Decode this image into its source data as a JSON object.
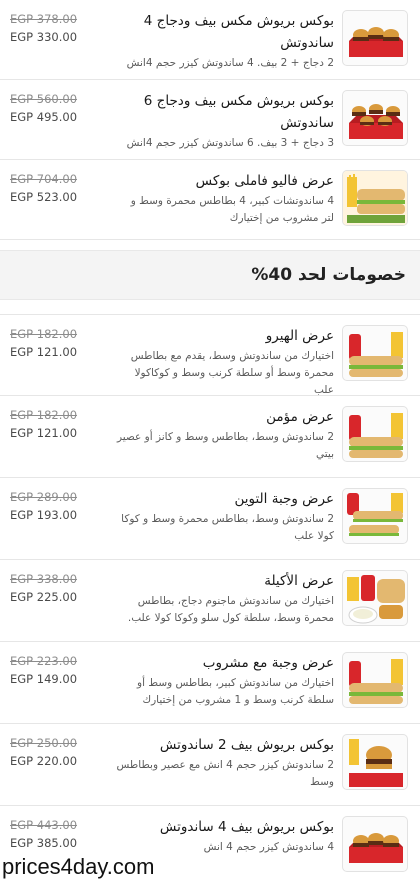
{
  "top_items": [
    {
      "title": "بوكس بريوش مكس بيف ودجاج 4 ساندوتش",
      "desc": "2 دجاج + 2 بيف. 4 ساندوتش كيزر حجم 4انش",
      "old_price": "EGP 378.00",
      "new_price": "EGP 330.00",
      "image": "sliders-box-image"
    },
    {
      "title": "بوكس بريوش مكس بيف ودجاج 6 ساندوتش",
      "desc": "3 دجاج + 3 بيف. 6 ساندوتش كيزر حجم 4انش",
      "old_price": "EGP 560.00",
      "new_price": "EGP 495.00",
      "image": "sliders-box-image"
    },
    {
      "title": "عرض فاليو فاملى بوكس",
      "desc": "4 ساندوتشات كبير، 4 بطاطس محمرة وسط و لتر مشروب من إختيارك",
      "old_price": "EGP 704.00",
      "new_price": "EGP 523.00",
      "image": "family-box-image"
    }
  ],
  "section": {
    "title": "خصومات لحد 40%"
  },
  "discount_items": [
    {
      "title": "عرض الهيرو",
      "desc": "اختيارك من ساندوتش وسط، يقدم مع بطاطس محمرة وسط أو سلطة كرنب وسط و كوكاكولا علب",
      "old_price": "EGP 182.00",
      "new_price": "EGP 121.00",
      "image": "sub-combo-image"
    },
    {
      "title": "عرض مؤمن",
      "desc": "2 ساندوتش وسط، بطاطس وسط و كانز أو عصير بيتي",
      "old_price": "EGP 182.00",
      "new_price": "EGP 121.00",
      "image": "sub-combo-image"
    },
    {
      "title": "عرض وجبة التوين",
      "desc": "2 ساندوتش وسط، بطاطس محمرة وسط و كوكا كولا علب",
      "old_price": "EGP 289.00",
      "new_price": "EGP 193.00",
      "image": "twin-meal-image"
    },
    {
      "title": "عرض الأكيلة",
      "desc": "اختيارك من ساندوتش ماجنوم دجاج، بطاطس محمرة وسط، سلطة كول سلو وكوكا كولا علب.",
      "old_price": "EGP 338.00",
      "new_price": "EGP 225.00",
      "image": "wrap-meal-image"
    },
    {
      "title": "عرض وجبة مع مشروب",
      "desc": "اختيارك من ساندوتش كبير، بطاطس وسط أو سلطة كرنب وسط و 1 مشروب من إختيارك",
      "old_price": "EGP 223.00",
      "new_price": "EGP 149.00",
      "image": "sub-combo-image"
    },
    {
      "title": "بوكس بريوش بيف 2 ساندوتش",
      "desc": "2 ساندوتش كيزر حجم 4 انش مع عصير وبطاطس وسط",
      "old_price": "EGP 250.00",
      "new_price": "EGP 220.00",
      "image": "burger-box-image"
    },
    {
      "title": "بوكس بريوش بيف 4 ساندوتش",
      "desc": "4 ساندوتش كيزر حجم 4 انش",
      "old_price": "EGP 443.00",
      "new_price": "EGP 385.00",
      "image": "sliders-box-image"
    }
  ],
  "watermark": "prices4day.com",
  "colors": {
    "bun": "#d99a3c",
    "patty": "#5a2d14",
    "box_red": "#d8262b",
    "fries": "#f3c434",
    "lettuce": "#79b83a",
    "bread": "#e3b870"
  }
}
